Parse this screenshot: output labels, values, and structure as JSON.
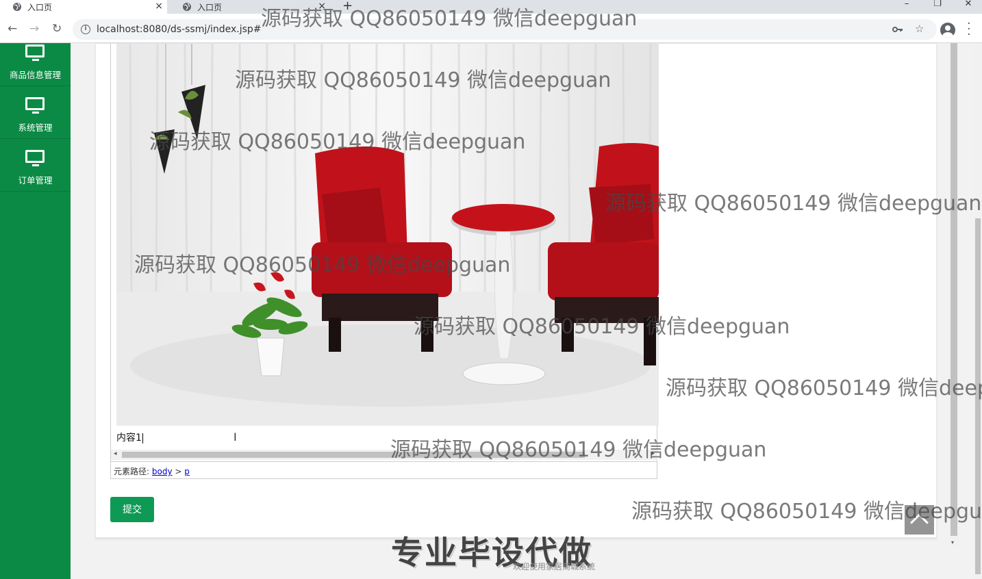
{
  "browser": {
    "tabs": [
      {
        "title": "入口页",
        "active": true
      },
      {
        "title": "入口页",
        "active": false
      }
    ],
    "close_glyph": "×",
    "new_tab_glyph": "+",
    "url": "localhost:8080/ds-ssmj/index.jsp#",
    "window_controls": {
      "minimize": "–",
      "restore": "❐",
      "close": "✕"
    },
    "nav": {
      "back": "←",
      "forward": "→",
      "reload": "↻"
    }
  },
  "sidebar": {
    "items": [
      {
        "label": "商品信息管理",
        "icon": "monitor-icon"
      },
      {
        "label": "系统管理",
        "icon": "monitor-icon"
      },
      {
        "label": "订单管理",
        "icon": "monitor-icon"
      }
    ]
  },
  "editor": {
    "content_text": "内容1",
    "element_path_label": "元素路径:",
    "path_body": "body",
    "path_sep": ">",
    "path_p": "p"
  },
  "form": {
    "submit_label": "提交"
  },
  "footer": {
    "overlay_text": "专业毕设代做",
    "welcome_text": "欢迎使用家居商城系统"
  },
  "watermark": {
    "text": "源码获取 QQ86050149 微信deepguan",
    "text_cut1": "源码获取 QQ86050149 微信deep",
    "text_cut2": "源码获取 QQ86050149 微信deepgua"
  },
  "colors": {
    "sidebar_green": "#0b8a45",
    "submit_green": "#0e9a55"
  }
}
